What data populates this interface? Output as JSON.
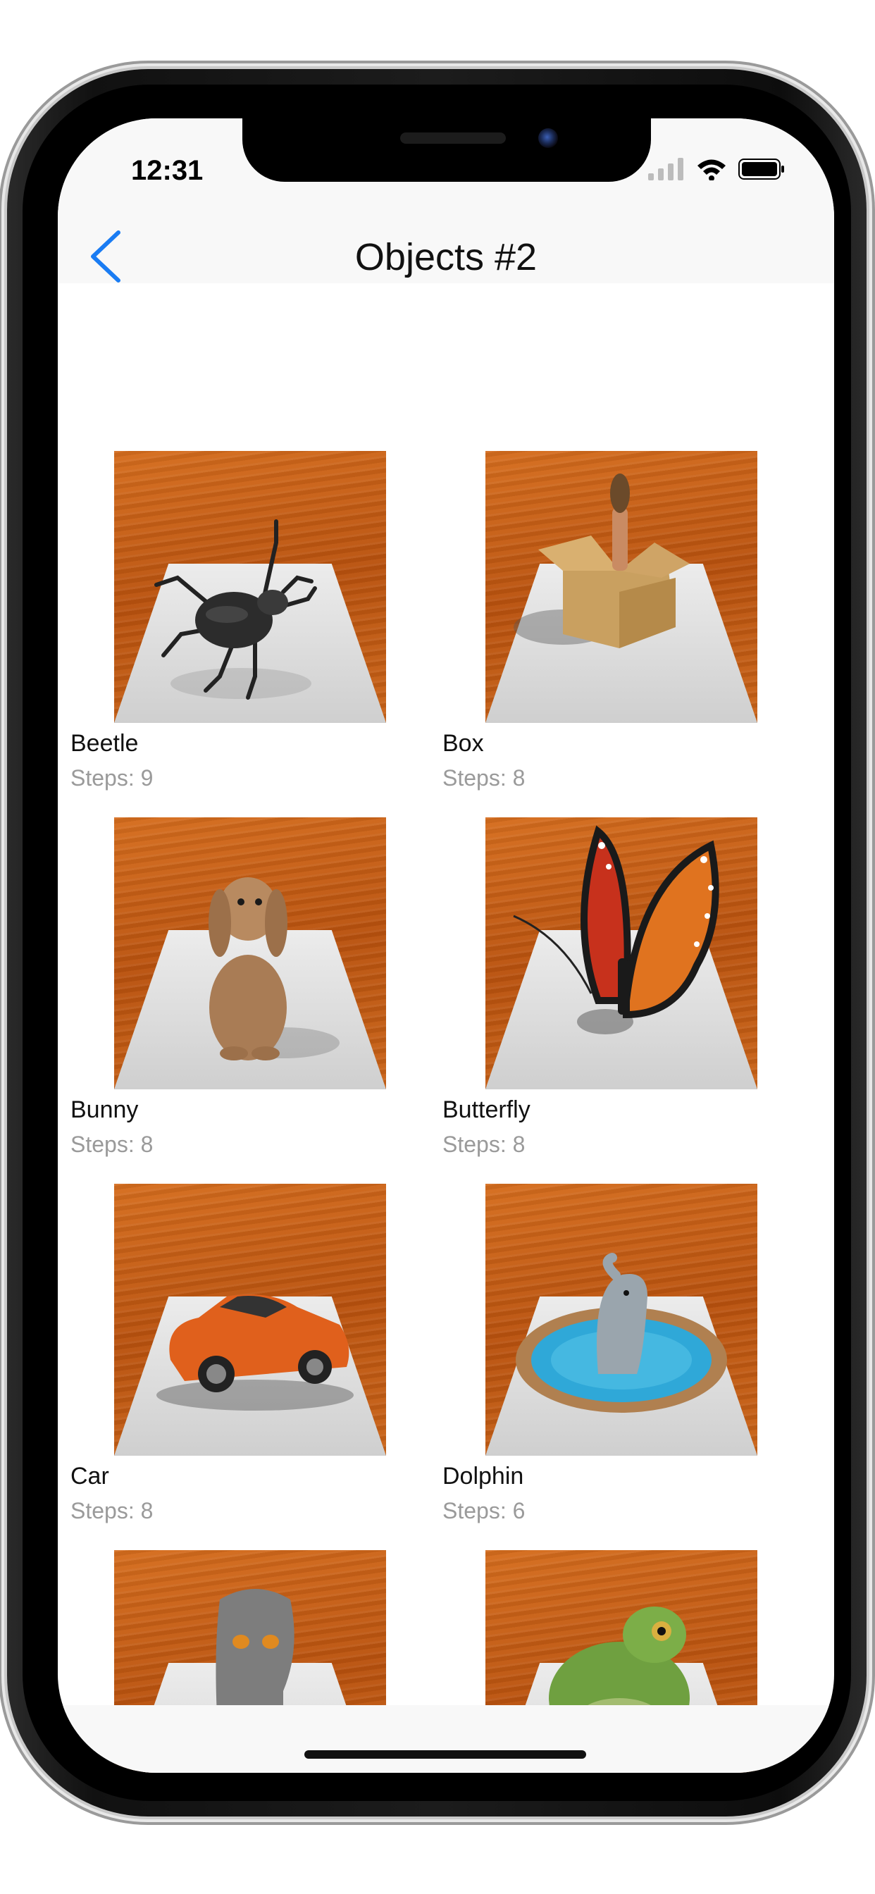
{
  "status": {
    "time": "12:31"
  },
  "nav": {
    "title": "Objects #2"
  },
  "items": [
    {
      "name": "Beetle",
      "steps": "Steps: 9",
      "icon": "beetle-drawing"
    },
    {
      "name": "Box",
      "steps": "Steps: 8",
      "icon": "box-drawing"
    },
    {
      "name": "Bunny",
      "steps": "Steps: 8",
      "icon": "bunny-drawing"
    },
    {
      "name": "Butterfly",
      "steps": "Steps: 8",
      "icon": "butterfly-drawing"
    },
    {
      "name": "Car",
      "steps": "Steps: 8",
      "icon": "car-drawing"
    },
    {
      "name": "Dolphin",
      "steps": "Steps: 6",
      "icon": "dolphin-drawing"
    },
    {
      "name": "",
      "steps": "",
      "icon": "mask-drawing"
    },
    {
      "name": "",
      "steps": "",
      "icon": "frog-drawing"
    }
  ],
  "colors": {
    "accent": "#1a7cf3",
    "steps_text": "#9a9a9a",
    "wood": "#c95f16"
  }
}
